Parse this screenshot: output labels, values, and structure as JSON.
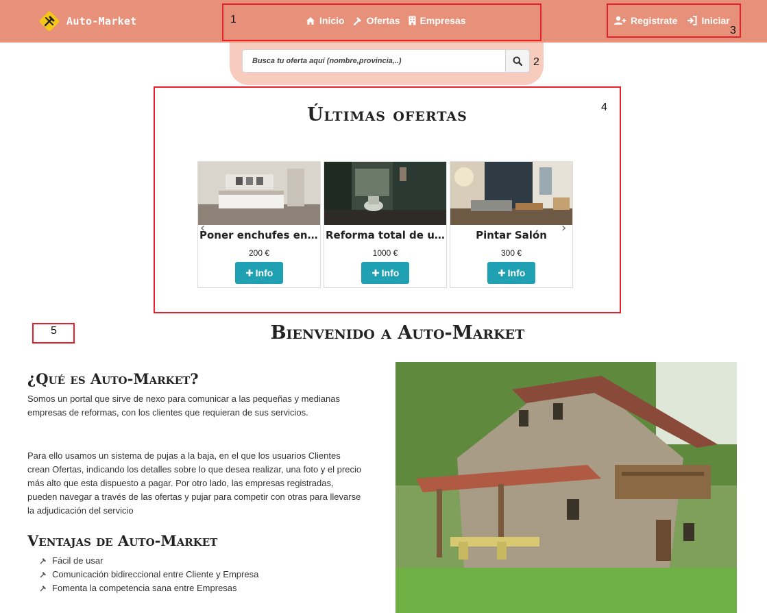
{
  "navbar": {
    "brand": "Auto-Market",
    "links": [
      {
        "label": "Inicio",
        "icon": "home-icon"
      },
      {
        "label": "Ofertas",
        "icon": "hammer-icon"
      },
      {
        "label": "Empresas",
        "icon": "building-icon"
      }
    ],
    "account": [
      {
        "label": "Registrate",
        "icon": "user-plus-icon"
      },
      {
        "label": "Iniciar",
        "icon": "sign-in-icon"
      }
    ]
  },
  "search": {
    "placeholder": "Busca tu oferta aquí (nombre,provincia,..)",
    "icon": "search-icon"
  },
  "annotations": [
    "1",
    "2",
    "3",
    "4",
    "5"
  ],
  "offers": {
    "title": "Últimas ofertas",
    "cards": [
      {
        "title": "Poner enchufes en ...",
        "price": "200 €",
        "button": "Info"
      },
      {
        "title": "Reforma total de u...",
        "price": "1000 €",
        "button": "Info"
      },
      {
        "title": "Pintar Salón",
        "price": "300 €",
        "button": "Info"
      }
    ]
  },
  "welcome": {
    "title": "Bienvenido a Auto-Market",
    "what_title": "¿Qué es Auto-Market?",
    "para1": "Somos un portal que sirve de nexo para comunicar a las pequeñas y medianas empresas de reformas, con los clientes que requieran de sus servicios.",
    "para2": "Para ello usamos un sistema de pujas a la baja, en el que los usuarios Clientes crean Ofertas, indicando los detalles sobre lo que desea realizar, una foto y el precio más alto que esta dispuesto a pagar. Por otro lado, las empresas registradas, pueden navegar a través de las ofertas y pujar para competir con otras para llevarse la adjudicación del servicio",
    "benefits_title": "Ventajas de Auto-Market",
    "benefits": [
      "Fácil de usar",
      "Comunicación bidireccional entre Cliente y Empresa",
      "Fomenta la competencia sana entre Empresas"
    ]
  },
  "colors": {
    "navbar": "#e8917a",
    "search_bg": "#f7cbbd",
    "info_button": "#1fa1b3",
    "annotation": "#e8202a",
    "brand_logo": "#f5c518"
  }
}
